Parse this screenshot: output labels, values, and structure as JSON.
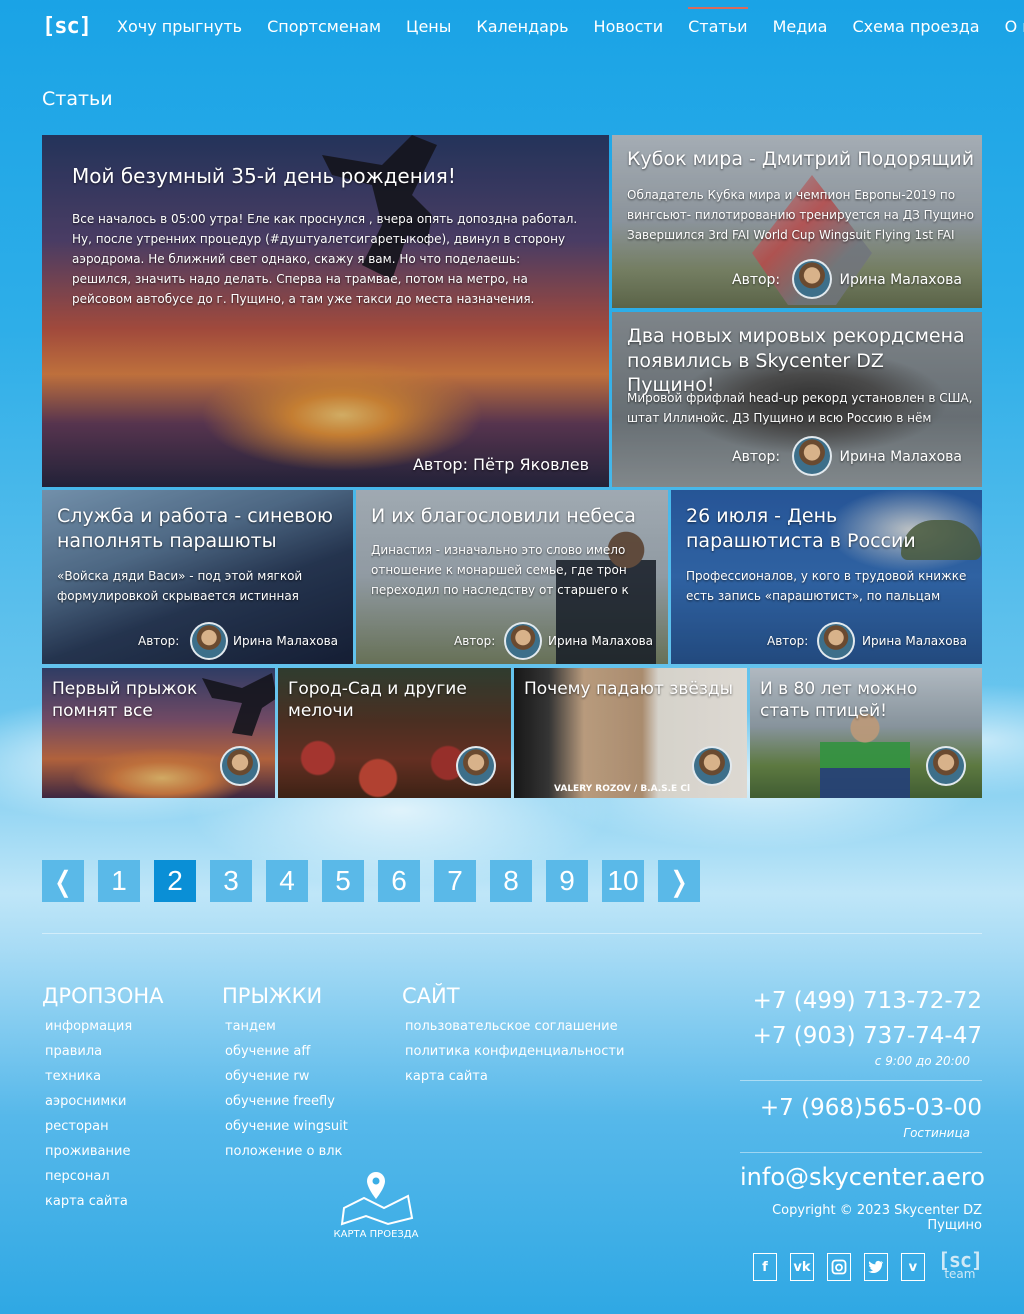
{
  "nav": {
    "logo": "[sc]",
    "items": [
      "Хочу прыгнуть",
      "Спортсменам",
      "Цены",
      "Календарь",
      "Новости",
      "Статьи",
      "Медиа",
      "Схема проезда",
      "О нас"
    ],
    "active": "Статьи"
  },
  "page_title": "Статьи",
  "articles": [
    {
      "title": "Мой безумный 35-й день рождения!",
      "excerpt": "Все началось в 05:00 утра! Еле как проснулся , вчера опять допоздна работал. Ну, после утренних процедур (#душтуалетсигаретыкофе), двинул в сторону аэродрома. Не ближний свет однако, скажу я вам. Но что поделаешь: решился, значить надо делать. Сперва на трамвае, потом на метро, на рейсовом автобусе до г. Пущино, а там уже такси до места назначения.",
      "author": "Автор: Пётр Яковлев"
    },
    {
      "title": "Кубок мира - Дмитрий Подорящий",
      "excerpt": "Обладатель Кубка мира и чемпион Европы-2019 по вингсьют- пилотированию тренируется на ДЗ Пущино Завершился 3rd FAI World Cup Wingsuit Flying 1st FAI",
      "author_label": "Автор:",
      "author": "Ирина Малахова"
    },
    {
      "title": "Два новых мировых рекордсмена появились в Skycenter DZ Пущино!",
      "excerpt": "Мировой фрифлай head-up рекорд установлен в США, штат Иллинойс. ДЗ Пущино и всю Россию в нём",
      "author_label": "Автор:",
      "author": "Ирина Малахова"
    },
    {
      "title": "Служба и работа - синевою наполнять парашюты",
      "excerpt": "«Войска дяди Васи» - под этой мягкой формулировкой скрывается истинная",
      "author_label": "Автор:",
      "author": "Ирина Малахова"
    },
    {
      "title": "И их благословили небеса",
      "excerpt": "Династия - изначально это слово имело отношение к монаршей семье, где трон переходил по наследству от старшего к",
      "author_label": "Автор:",
      "author": "Ирина Малахова"
    },
    {
      "title": "26 июля - День парашютиста в России",
      "excerpt": "Профессионалов, у кого в трудовой книжке есть запись «парашютист», по пальцам можно",
      "author_label": "Автор:",
      "author": "Ирина Малахова"
    },
    {
      "title": "Первый прыжок помнят все"
    },
    {
      "title": "Город-Сад и другие мелочи"
    },
    {
      "title": "Почему падают звёзды",
      "image_caption": "VALERY ROZOV / B.A.S.E Cl"
    },
    {
      "title": "И в 80 лет можно стать птицей!"
    }
  ],
  "pagination": {
    "prev": "❬",
    "pages": [
      "1",
      "2",
      "3",
      "4",
      "5",
      "6",
      "7",
      "8",
      "9",
      "10"
    ],
    "current": "2",
    "next": "❭"
  },
  "footer": {
    "columns": [
      {
        "title": "ДРОПЗОНА",
        "links": [
          "информация",
          "правила",
          "техника",
          "аэроснимки",
          "ресторан",
          "проживание",
          "персонал",
          "карта сайта"
        ]
      },
      {
        "title": "ПРЫЖКИ",
        "links": [
          "тандем",
          "обучение aff",
          "обучение rw",
          "обучение freefly",
          "обучение wingsuit",
          "положение о влк"
        ]
      },
      {
        "title": "САЙТ",
        "links": [
          "пользовательское соглашение",
          "политика конфиденциальности",
          "карта сайта"
        ]
      }
    ],
    "map_label": "КАРТА ПРОЕЗДА",
    "phone1": "+7 (499) 713-72-72",
    "phone2": "+7 (903) 737-74-47",
    "hours": "с 9:00 до 20:00",
    "phone3": "+7 (968)565-03-00",
    "phone3_label": "Гостиница",
    "email": "info@skycenter.aero",
    "copyright": "Copyright © 2023 Skycenter DZ Пущино",
    "socials": [
      "facebook-icon",
      "vk-icon",
      "instagram-icon",
      "twitter-icon",
      "vimeo-icon"
    ],
    "team_logo": "[sc]",
    "team_label": "team"
  },
  "colors": {
    "accent_active_page": "#0a8fd6",
    "page_button": "#5ab9e8",
    "nav_active_underline": "#d96a5c"
  }
}
